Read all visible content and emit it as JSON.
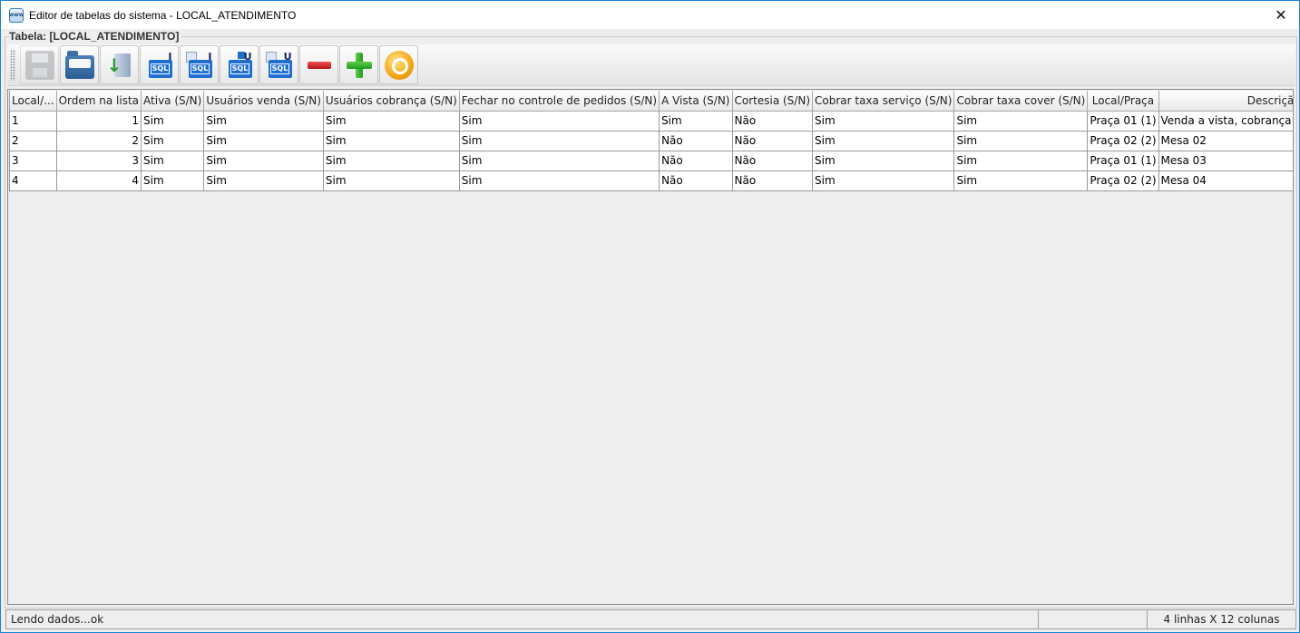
{
  "window": {
    "title": "Editor de tabelas do sistema - LOCAL_ATENDIMENTO",
    "icon": "app-icon",
    "close_glyph": "✕"
  },
  "panel": {
    "label": "Tabela: [LOCAL_ATENDIMENTO]"
  },
  "toolbar": {
    "buttons": [
      {
        "name": "save-button",
        "icon": "save-icon",
        "enabled": false
      },
      {
        "name": "open-button",
        "icon": "folder-open-icon",
        "enabled": true
      },
      {
        "name": "import-button",
        "icon": "import-icon",
        "enabled": true
      },
      {
        "name": "sql-insert-button",
        "icon": "sql-insert-icon",
        "letter": "I",
        "enabled": true
      },
      {
        "name": "sql-insert-file-button",
        "icon": "sql-insert-file-icon",
        "letter": "I",
        "enabled": true
      },
      {
        "name": "sql-update-button",
        "icon": "sql-update-icon",
        "letter": "U",
        "enabled": true
      },
      {
        "name": "sql-update-file-button",
        "icon": "sql-update-file-icon",
        "letter": "U",
        "enabled": true
      },
      {
        "name": "remove-row-button",
        "icon": "minus-icon",
        "enabled": true
      },
      {
        "name": "add-row-button",
        "icon": "plus-icon",
        "enabled": true
      },
      {
        "name": "refresh-button",
        "icon": "refresh-icon",
        "enabled": true
      }
    ],
    "sql_badge": "SQL"
  },
  "table": {
    "columns": [
      "Local/...",
      "Ordem na lista",
      "Ativa (S/N)",
      "Usuários venda (S/N)",
      "Usuários cobrança (S/N)",
      "Fechar no controle de pedidos (S/N)",
      "A Vista (S/N)",
      "Cortesia (S/N)",
      "Cobrar taxa serviço (S/N)",
      "Cobrar taxa cover (S/N)",
      "Local/Praça",
      "Descrição"
    ],
    "rows": [
      [
        "1",
        "1",
        "Sim",
        "Sim",
        "Sim",
        "Sim",
        "Sim",
        "Não",
        "Sim",
        "Sim",
        "Praça 01 (1)",
        "Venda a vista, cobrança no ato do pedido"
      ],
      [
        "2",
        "2",
        "Sim",
        "Sim",
        "Sim",
        "Sim",
        "Não",
        "Não",
        "Sim",
        "Sim",
        "Praça 02 (2)",
        "Mesa 02"
      ],
      [
        "3",
        "3",
        "Sim",
        "Sim",
        "Sim",
        "Sim",
        "Não",
        "Não",
        "Sim",
        "Sim",
        "Praça 01 (1)",
        "Mesa 03"
      ],
      [
        "4",
        "4",
        "Sim",
        "Sim",
        "Sim",
        "Sim",
        "Não",
        "Não",
        "Sim",
        "Sim",
        "Praça 02 (2)",
        "Mesa 04"
      ]
    ]
  },
  "status": {
    "message": "Lendo dados...ok",
    "middle": "",
    "summary": "4 linhas X 12 colunas"
  }
}
